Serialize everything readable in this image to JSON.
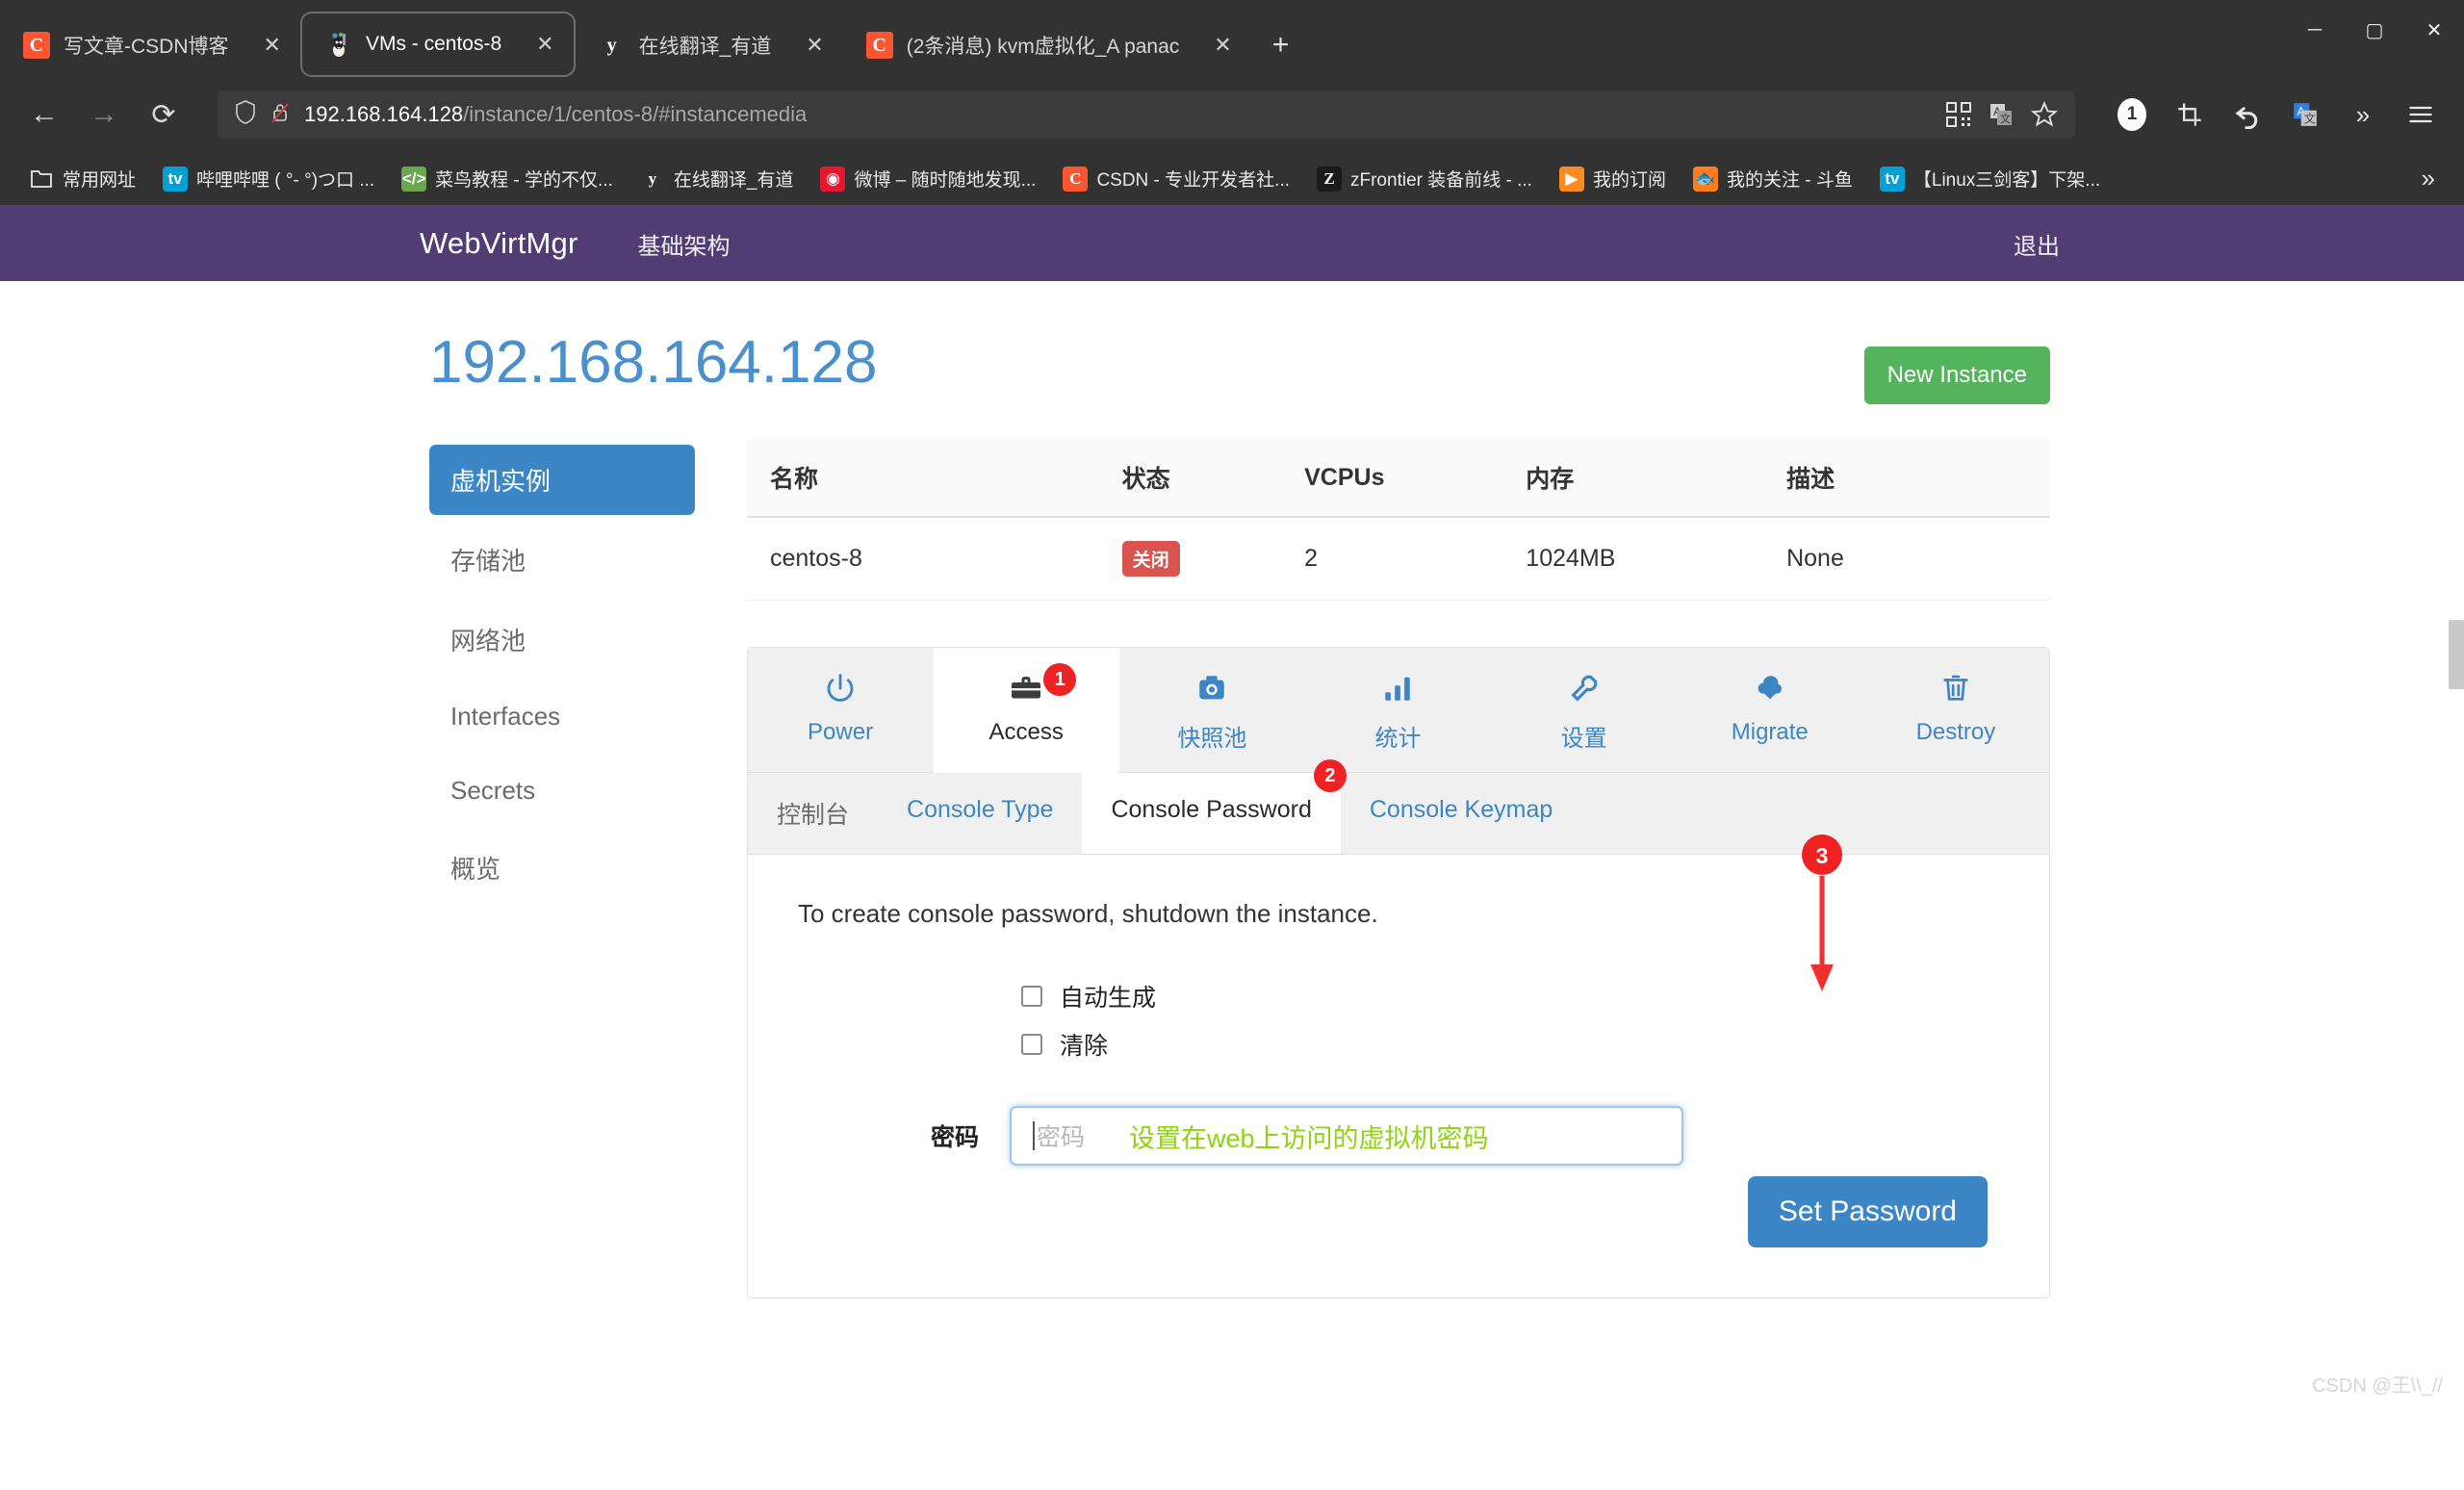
{
  "browser": {
    "tabs": [
      {
        "title": "写文章-CSDN博客",
        "icon": "csdn-icon",
        "active": false,
        "close_label": "✕"
      },
      {
        "title": "VMs - centos-8",
        "icon": "virt-manager-icon",
        "active": true,
        "close_label": "✕"
      },
      {
        "title": "在线翻译_有道",
        "icon": "youdao-icon",
        "active": false,
        "close_label": "✕"
      },
      {
        "title": "(2条消息) kvm虚拟化_A panac",
        "icon": "csdn-icon",
        "active": false,
        "close_label": "✕"
      }
    ],
    "new_tab_label": "+",
    "window_controls": {
      "minimize": "─",
      "maximize": "▢",
      "close": "✕"
    },
    "nav": {
      "back": "←",
      "forward": "→",
      "reload": "⟳",
      "url_host": "192.168.164.128",
      "url_path": "/instance/1/centos-8/#instancemedia"
    },
    "omnibox_icons": [
      "shield-icon",
      "insecure-lock-icon",
      "qrcode-icon",
      "translate-icon",
      "bookmark-star-icon"
    ],
    "toolbar_icons": [
      "collections-badge-1",
      "screenshot-crop-icon",
      "undo-arrow-icon",
      "translate-icon",
      "extensions-chevron-icon",
      "menu-icon"
    ],
    "toolbar_badge": "1",
    "bookmarks": [
      {
        "label": "常用网址",
        "icon": "folder-icon"
      },
      {
        "label": "哔哩哔哩 ( °- °)つ口 ...",
        "icon": "bilibili-icon"
      },
      {
        "label": "菜鸟教程 - 学的不仅...",
        "icon": "runoob-icon"
      },
      {
        "label": "在线翻译_有道",
        "icon": "youdao-icon"
      },
      {
        "label": "微博 – 随时随地发现...",
        "icon": "weibo-icon"
      },
      {
        "label": "CSDN - 专业开发者社...",
        "icon": "csdn-icon"
      },
      {
        "label": "zFrontier 装备前线 - ...",
        "icon": "zfrontier-icon"
      },
      {
        "label": "我的订阅",
        "icon": "subscribe-icon"
      },
      {
        "label": "我的关注 - 斗鱼",
        "icon": "douyu-icon"
      },
      {
        "label": "【Linux三剑客】下架...",
        "icon": "bilibili-icon"
      }
    ],
    "bookmarks_overflow": "»"
  },
  "app": {
    "brand": "WebVirtMgr",
    "nav_link": "基础架构",
    "logout": "退出",
    "accent_purple": "#513c73",
    "accent_blue": "#3d86c6",
    "accent_green": "#53b45b"
  },
  "page": {
    "title": "192.168.164.128",
    "new_instance_label": "New Instance"
  },
  "sidebar": {
    "items": [
      {
        "label": "虚机实例",
        "active": true
      },
      {
        "label": "存储池",
        "active": false
      },
      {
        "label": "网络池",
        "active": false
      },
      {
        "label": "Interfaces",
        "active": false
      },
      {
        "label": "Secrets",
        "active": false
      },
      {
        "label": "概览",
        "active": false
      }
    ]
  },
  "table": {
    "headers": [
      "名称",
      "状态",
      "VCPUs",
      "内存",
      "描述"
    ],
    "rows": [
      {
        "name": "centos-8",
        "state": "关闭",
        "vcpus": "2",
        "memory": "1024MB",
        "description": "None"
      }
    ]
  },
  "tabs": {
    "items": [
      {
        "label": "Power",
        "icon": "power-icon",
        "active": false
      },
      {
        "label": "Access",
        "icon": "briefcase-icon",
        "active": true,
        "badge": "1"
      },
      {
        "label": "快照池",
        "icon": "camera-icon",
        "active": false
      },
      {
        "label": "统计",
        "icon": "bar-chart-icon",
        "active": false
      },
      {
        "label": "设置",
        "icon": "wrench-icon",
        "active": false
      },
      {
        "label": "Migrate",
        "icon": "cloud-download-icon",
        "active": false
      },
      {
        "label": "Destroy",
        "icon": "trash-icon",
        "active": false
      }
    ]
  },
  "subtabs": {
    "items": [
      {
        "label": "控制台",
        "active": false,
        "zh": true
      },
      {
        "label": "Console Type",
        "active": false
      },
      {
        "label": "Console Password",
        "active": true,
        "badge": "2"
      },
      {
        "label": "Console Keymap",
        "active": false
      }
    ]
  },
  "form": {
    "note": "To create console password, shutdown the instance.",
    "checkboxes": [
      {
        "label": "自动生成",
        "checked": false
      },
      {
        "label": "清除",
        "checked": false
      }
    ],
    "password_label": "密码",
    "password_placeholder": "密码",
    "password_value": "",
    "annotation_green": "设置在web上访问的虚拟机密码",
    "submit_label": "Set Password",
    "annotation_badge_3": "3"
  },
  "watermark": "CSDN @王\\\\_//"
}
